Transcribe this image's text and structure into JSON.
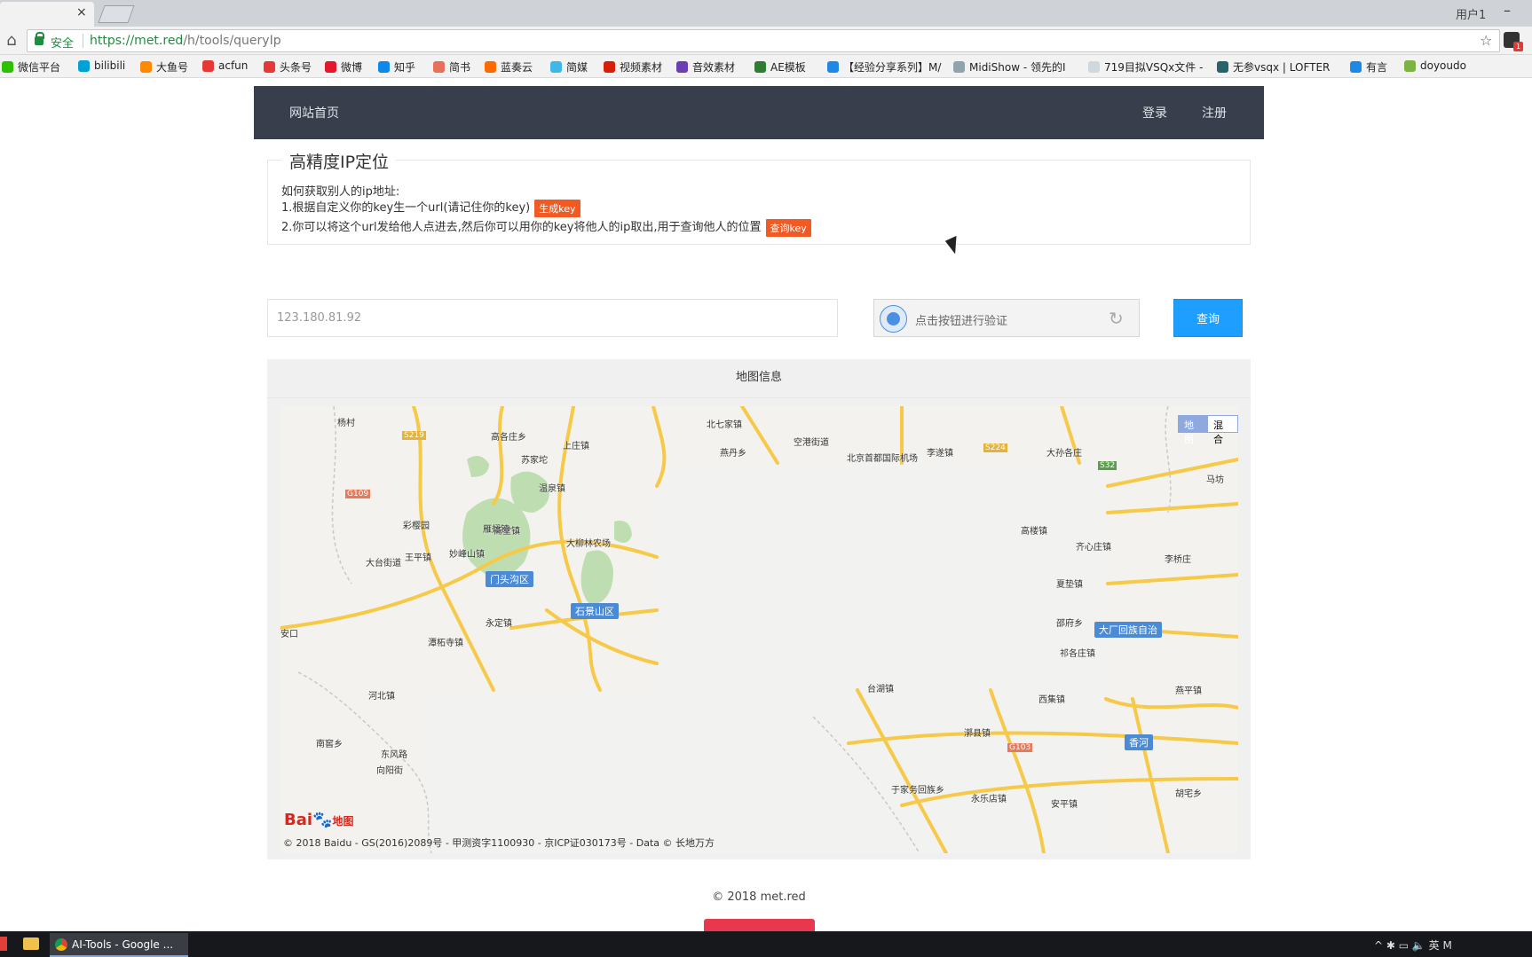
{
  "browser": {
    "tab_close": "×",
    "user_label": "用户1",
    "minimize": "–",
    "secure_label": "安全",
    "url_host": "https://met.red",
    "url_path": "/h/tools/queryIp",
    "home_icon": "home-icon",
    "star_icon": "star-icon"
  },
  "bookmarks": [
    {
      "label": "微信平台",
      "color": "#2dc100"
    },
    {
      "label": "bilibili",
      "color": "#00a1d6"
    },
    {
      "label": "大鱼号",
      "color": "#ff8a00"
    },
    {
      "label": "acfun",
      "color": "#e53935"
    },
    {
      "label": "头条号",
      "color": "#e53935"
    },
    {
      "label": "微博",
      "color": "#e6162d"
    },
    {
      "label": "知乎",
      "color": "#0f88eb"
    },
    {
      "label": "简书",
      "color": "#ea6f5a"
    },
    {
      "label": "蓝奏云",
      "color": "#ff6a00"
    },
    {
      "label": "简媒",
      "color": "#3db8e8"
    },
    {
      "label": "视频素材",
      "color": "#d81e06"
    },
    {
      "label": "音效素材",
      "color": "#6a3fb3"
    },
    {
      "label": "AE模板",
      "color": "#2e7d32"
    },
    {
      "label": "【经验分享系列】M/",
      "color": "#1e88e5"
    },
    {
      "label": "MidiShow - 领先的I",
      "color": "#90a4ae"
    },
    {
      "label": "719目拟VSQx文件 -",
      "color": "#cfd8dc"
    },
    {
      "label": "无参vsqx | LOFTER",
      "color": "#26636b"
    },
    {
      "label": "有言",
      "color": "#1e88e5"
    },
    {
      "label": "doyoudo",
      "color": "#7cb342"
    }
  ],
  "nav": {
    "home": "网站首页",
    "login": "登录",
    "register": "注册"
  },
  "info": {
    "legend": "高精度IP定位",
    "line1": "如何获取别人的ip地址:",
    "line2": "1.根据自定义你的key生一个url(请记住你的key)",
    "badge_generate": "生成key",
    "line3": "2.你可以将这个url发给他人点进去,然后你可以用你的key将他人的ip取出,用于查询他人的位置",
    "badge_query": "查询key"
  },
  "query": {
    "ip_value": "123.180.81.92",
    "captcha_text": "点击按钮进行验证",
    "button_label": "查询"
  },
  "map": {
    "header": "地图信息",
    "type_map": "地图",
    "type_hybrid": "混合",
    "logo_text": "Bai",
    "logo_paw": "🐾",
    "logo_text2": "地图",
    "copyright": "© 2018 Baidu - GS(2016)2089号 - 甲测资字1100930 - 京ICP证030173号 - Data © 长地万方",
    "places": [
      "杨村",
      "高各庄乡",
      "上庄镇",
      "北七家镇",
      "苏家坨",
      "燕丹乡",
      "空港街道",
      "北京首都国际机场",
      "李遂镇",
      "大孙各庄",
      "马坊",
      "温泉镇",
      "彩樱园",
      "雁翅镇",
      "王平镇",
      "妙峰山镇",
      "大台街道",
      "斋堂镇",
      "大柳林农场",
      "高楼镇",
      "齐心庄镇",
      "李桥庄",
      "夏垫镇",
      "永定镇",
      "潭柘寺镇",
      "邵府乡",
      "祁各庄镇",
      "安口",
      "河北镇",
      "台湖镇",
      "西集镇",
      "漷县镇",
      "燕平镇",
      "南窖乡",
      "东风路",
      "向阳街",
      "于家务回族乡",
      "永乐店镇",
      "安平镇",
      "胡宅乡"
    ],
    "districts": [
      "门头沟区",
      "石景山区",
      "大厂回族自治",
      "香河"
    ],
    "road_codes": [
      "S219",
      "G109",
      "S224",
      "S32",
      "G103"
    ]
  },
  "footer": {
    "copyright": "© 2018 met.red"
  },
  "taskbar": {
    "chrome_label": "AI-Tools - Google ...",
    "tray_text": "^ ✱ ▭ 🔈 英 M"
  },
  "colors": {
    "navbar": "#383e4c",
    "accent_button": "#1e9fff",
    "badge": "#f15a22"
  }
}
